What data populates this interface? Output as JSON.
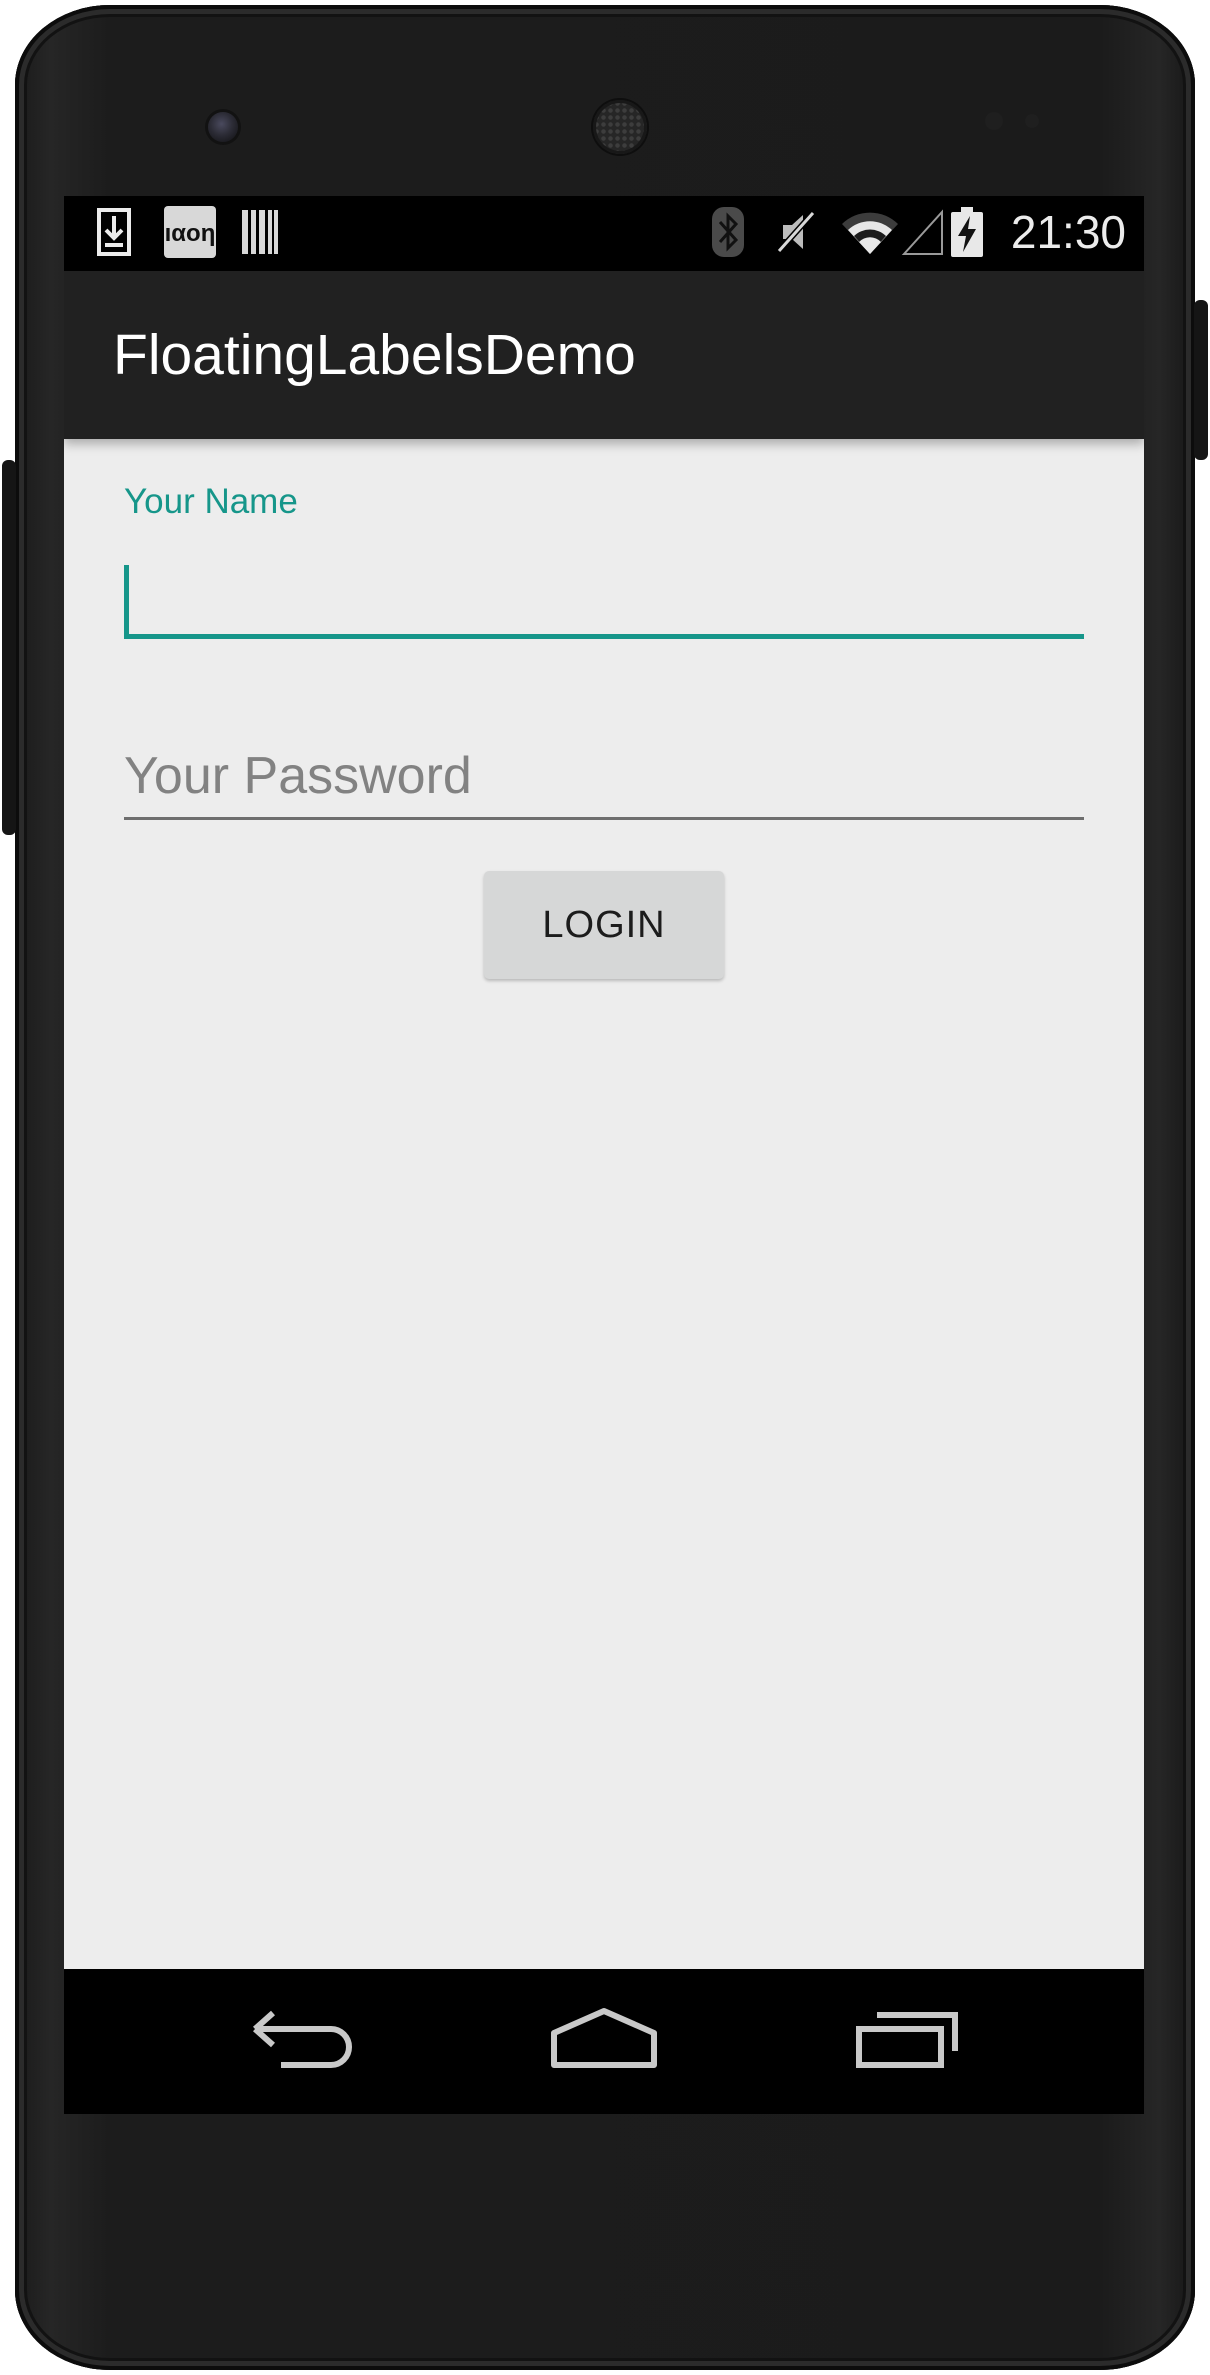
{
  "status_bar": {
    "time": "21:30",
    "notification_icons": [
      "download-icon",
      "sim-card-icon",
      "barcode-icon"
    ],
    "system_icons": [
      "bluetooth-icon",
      "mute-icon",
      "wifi-icon",
      "cell-signal-icon",
      "battery-charging-icon"
    ]
  },
  "action_bar": {
    "title": "FloatingLabelsDemo"
  },
  "form": {
    "name_label": "Your Name",
    "name_value": "",
    "password_placeholder": "Your Password",
    "password_value": "",
    "login_label": "LOGIN"
  },
  "nav_bar": {
    "buttons": [
      "back-icon",
      "home-icon",
      "recent-apps-icon"
    ]
  },
  "colors": {
    "accent": "#16968a",
    "action_bar": "#212121",
    "content_background": "#ededed",
    "button": "#d6d7d7"
  }
}
